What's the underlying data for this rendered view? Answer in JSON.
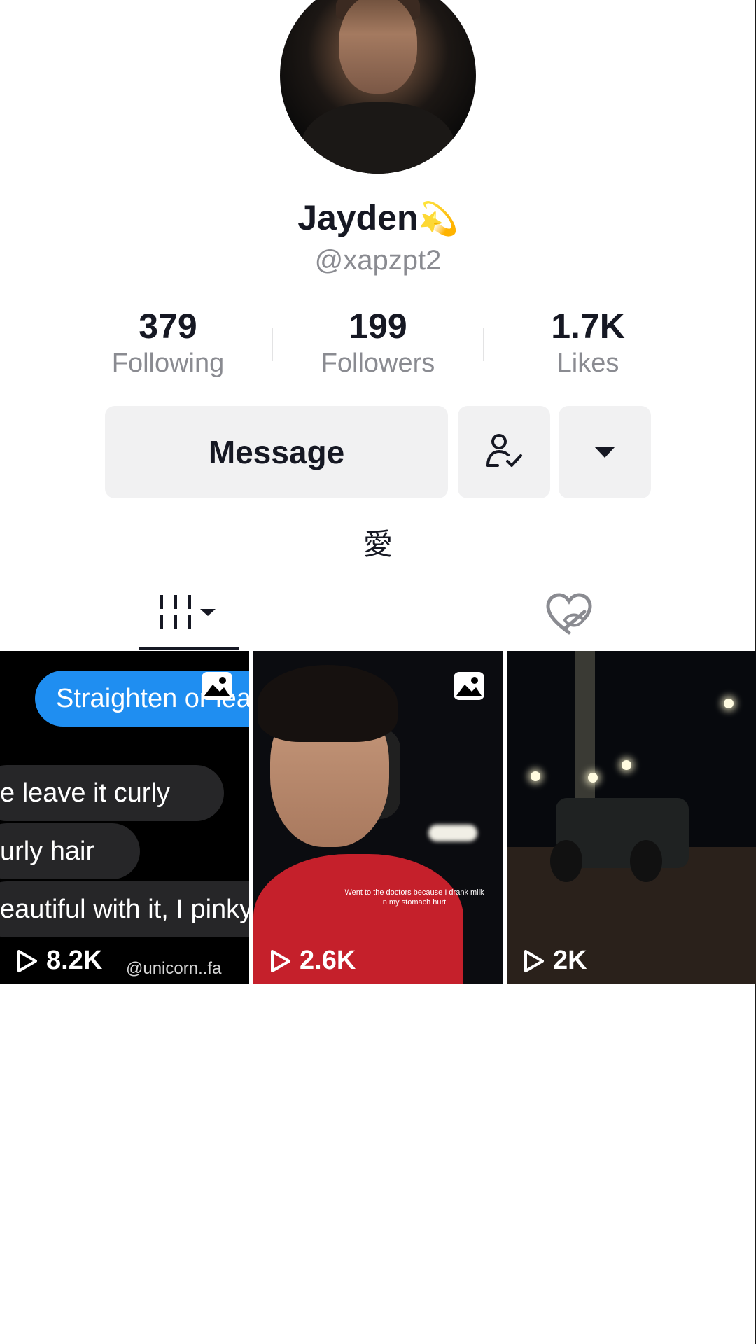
{
  "profile": {
    "display_name": "Jayden",
    "name_emoji": "💫",
    "username": "@xapzpt2",
    "bio": "愛"
  },
  "stats": {
    "following_count": "379",
    "following_label": "Following",
    "followers_count": "199",
    "followers_label": "Followers",
    "likes_count": "1.7K",
    "likes_label": "Likes"
  },
  "actions": {
    "message_label": "Message",
    "follow_icon": "user-check-icon",
    "more_icon": "caret-down-icon"
  },
  "tabs": [
    {
      "icon": "videos-grid-icon",
      "selected": true
    },
    {
      "icon": "liked-hidden-heart-icon",
      "selected": false
    }
  ],
  "videos": [
    {
      "views": "8.2K",
      "has_photo_badge": true,
      "bubbles": {
        "blue": "Straighten or lea",
        "gray1": "e leave it curly",
        "gray2": "urly hair",
        "gray3": "eautiful with it, I pinky"
      },
      "watermark": "@unicorn..fa"
    },
    {
      "views": "2.6K",
      "has_photo_badge": true,
      "caption": "Went to the doctors because I drank milk n my stomach hurt"
    },
    {
      "views": "2K",
      "has_photo_badge": false
    }
  ],
  "colors": {
    "accent_blue": "#1f8ef1",
    "button_bg": "#f1f1f2",
    "secondary_text": "#8a8b91"
  }
}
